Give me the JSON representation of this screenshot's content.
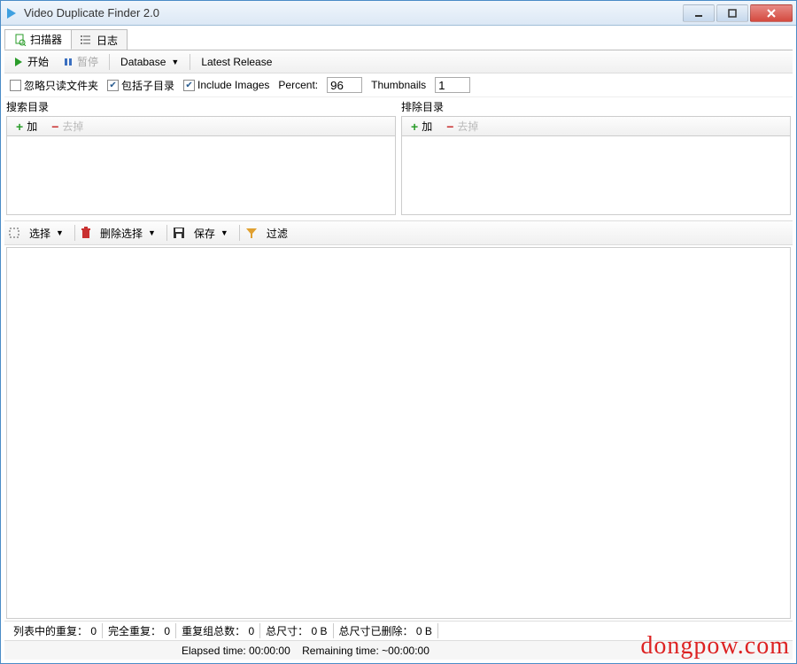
{
  "window": {
    "title": "Video Duplicate Finder 2.0"
  },
  "tabs": {
    "scanner": "扫描器",
    "log": "日志"
  },
  "toolbar": {
    "start": "开始",
    "pause": "暂停",
    "database": "Database",
    "latest": "Latest Release"
  },
  "options": {
    "ignoreReadonly": "忽略只读文件夹",
    "includeSub": "包括子目录",
    "includeImages": "Include Images",
    "percentLabel": "Percent:",
    "percentValue": "96",
    "thumbLabel": "Thumbnails",
    "thumbValue": "1"
  },
  "dirs": {
    "searchLabel": "搜索目录",
    "excludeLabel": "排除目录",
    "add": "加",
    "remove": "去掉"
  },
  "toolbar2": {
    "select": "选择",
    "deleteSel": "删除选择",
    "save": "保存",
    "filter": "过滤"
  },
  "status": {
    "listDup": "列表中的重复：",
    "listDupVal": "0",
    "fullDup": "完全重复：",
    "fullDupVal": "0",
    "groups": "重复组总数：",
    "groupsVal": "0",
    "totalSize": "总尺寸：",
    "totalSizeVal": "0 B",
    "delSize": "总尺寸已删除：",
    "delSizeVal": "0 B"
  },
  "time": {
    "elapsedLabel": "Elapsed time:",
    "elapsedVal": "00:00:00",
    "remainLabel": "Remaining time:",
    "remainVal": "~00:00:00"
  },
  "watermark": "dongpow.com"
}
